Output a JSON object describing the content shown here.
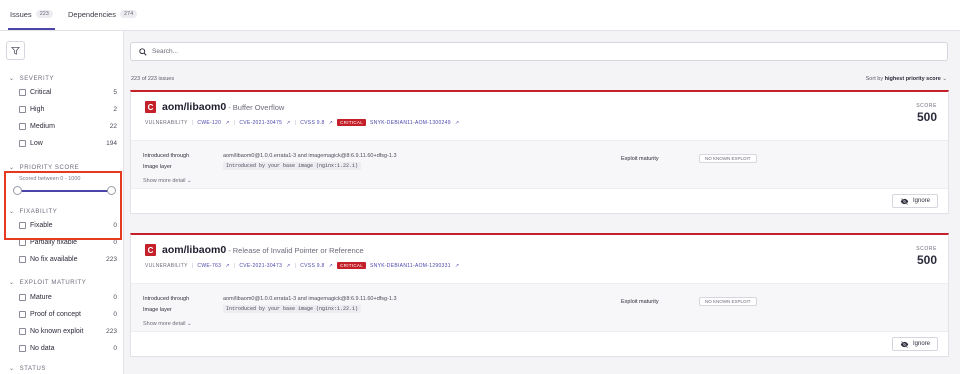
{
  "tabs": [
    {
      "label": "Issues",
      "count": "223"
    },
    {
      "label": "Dependencies",
      "count": "274"
    }
  ],
  "filters": {
    "severity": {
      "title": "SEVERITY",
      "items": [
        {
          "label": "Critical",
          "count": "5"
        },
        {
          "label": "High",
          "count": "2"
        },
        {
          "label": "Medium",
          "count": "22"
        },
        {
          "label": "Low",
          "count": "194"
        }
      ]
    },
    "priority_score": {
      "title": "PRIORITY SCORE",
      "subtitle": "Scored between 0 - 1000"
    },
    "fixability": {
      "title": "FIXABILITY",
      "items": [
        {
          "label": "Fixable",
          "count": "0"
        },
        {
          "label": "Partially fixable",
          "count": "0"
        },
        {
          "label": "No fix available",
          "count": "223"
        }
      ]
    },
    "exploit_maturity": {
      "title": "EXPLOIT MATURITY",
      "items": [
        {
          "label": "Mature",
          "count": "0"
        },
        {
          "label": "Proof of concept",
          "count": "0"
        },
        {
          "label": "No known exploit",
          "count": "223"
        },
        {
          "label": "No data",
          "count": "0"
        }
      ]
    },
    "status": {
      "title": "STATUS"
    }
  },
  "search": {
    "placeholder": "Search..."
  },
  "summary": "223 of 223 issues",
  "sort": {
    "prefix": "Sort by",
    "value": "highest priority score"
  },
  "labels": {
    "vulnerability": "VULNERABILITY",
    "score": "SCORE",
    "introduced": "Introduced through",
    "image_layer": "Image layer",
    "exploit": "Exploit maturity",
    "show_more": "Show more detail",
    "ignore": "Ignore"
  },
  "issues": [
    {
      "severity_letter": "C",
      "package": "aom/libaom0",
      "title": "- Buffer Overflow",
      "cwe": "CWE-120",
      "cve": "CVE-2021-30475",
      "cvss": "CVSS 9.8",
      "severity": "CRITICAL",
      "snyk_id": "SNYK-DEBIAN11-AOM-1300249",
      "score": "500",
      "introduced_through": "aom/libaom0@1.0.0.errata1-3 and imagemagick@8:6.9.11.60+dfsg-1.3",
      "image_layer": "Introduced by your base image (nginx:1.22.1)",
      "exploit_maturity": "NO KNOWN EXPLOIT"
    },
    {
      "severity_letter": "C",
      "package": "aom/libaom0",
      "title": "- Release of Invalid Pointer or Reference",
      "cwe": "CWE-763",
      "cve": "CVE-2021-30473",
      "cvss": "CVSS 9.8",
      "severity": "CRITICAL",
      "snyk_id": "SNYK-DEBIAN11-AOM-1290331",
      "score": "500",
      "introduced_through": "aom/libaom0@1.0.0.errata1-3 and imagemagick@8:6.9.11.60+dfsg-1.3",
      "image_layer": "Introduced by your base image (nginx:1.22.1)",
      "exploit_maturity": "NO KNOWN EXPLOIT"
    }
  ]
}
